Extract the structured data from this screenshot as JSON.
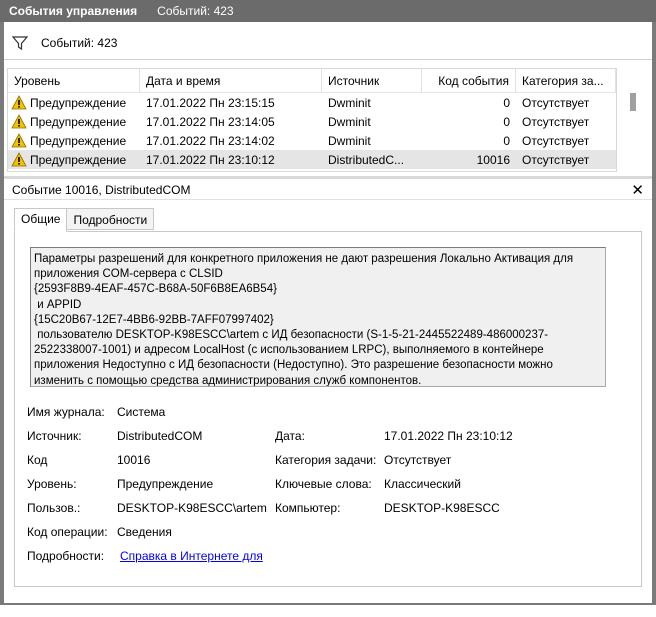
{
  "titlebar": {
    "title": "События управления",
    "count": "Событий: 423"
  },
  "filter": {
    "count": "Событий: 423",
    "icon": "filter-icon"
  },
  "grid": {
    "columns": [
      "Уровень",
      "Дата и время",
      "Источник",
      "Код события",
      "Категория за..."
    ],
    "rows": [
      {
        "level": "Предупреждение",
        "datetime": "17.01.2022 Пн 23:15:15",
        "source": "Dwminit",
        "code": "0",
        "category": "Отсутствует"
      },
      {
        "level": "Предупреждение",
        "datetime": "17.01.2022 Пн 23:14:05",
        "source": "Dwminit",
        "code": "0",
        "category": "Отсутствует"
      },
      {
        "level": "Предупреждение",
        "datetime": "17.01.2022 Пн 23:14:02",
        "source": "Dwminit",
        "code": "0",
        "category": "Отсутствует"
      },
      {
        "level": "Предупреждение",
        "datetime": "17.01.2022 Пн 23:10:12",
        "source": "DistributedC...",
        "code": "10016",
        "category": "Отсутствует"
      }
    ]
  },
  "detail": {
    "title": "Событие 10016, DistributedCOM",
    "tabs": [
      "Общие",
      "Подробности"
    ],
    "message": "Параметры разрешений для конкретного приложения не дают разрешения Локально Активация для\nприложения COM-сервера с CLSID\n{2593F8B9-4EAF-457C-B68A-50F6B8EA6B54}\n и APPID\n{15C20B67-12E7-4BB6-92BB-7AFF07997402}\n пользователю DESKTOP-K98ESCC\\artem с ИД безопасности (S-1-5-21-2445522489-486000237-\n2522338007-1001) и адресом LocalHost (с использованием LRPC), выполняемого в контейнере\nприложения Недоступно с ИД безопасности (Недоступно). Это разрешение безопасности можно\nизменить с помощью средства администрирования служб компонентов.",
    "fields": {
      "log_label": "Имя журнала:",
      "log_value": "Система",
      "source_label": "Источник:",
      "source_value": "DistributedCOM",
      "date_label": "Дата:",
      "date_value": "17.01.2022 Пн 23:10:12",
      "code_label": "Код",
      "code_value": "10016",
      "task_label": "Категория задачи:",
      "task_value": "Отсутствует",
      "level_label": "Уровень:",
      "level_value": "Предупреждение",
      "keywords_label": "Ключевые слова:",
      "keywords_value": "Классический",
      "user_label": "Пользов.:",
      "user_value": "DESKTOP-K98ESCC\\artem",
      "computer_label": "Компьютер:",
      "computer_value": "DESKTOP-K98ESCC",
      "opcode_label": "Код операции:",
      "opcode_value": "Сведения",
      "details_label": "Подробности:",
      "details_link": "Справка в Интернете для "
    }
  },
  "colors": {
    "titlebar": "#6b6b6b",
    "selected_row": "#e5e5e5",
    "warning": "#f2c200",
    "link": "#0000ee"
  }
}
